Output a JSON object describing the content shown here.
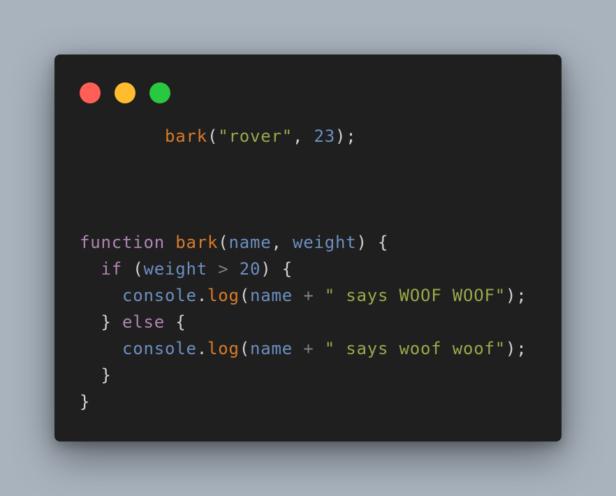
{
  "window": {
    "buttons": {
      "close": "close",
      "minimize": "minimize",
      "maximize": "maximize"
    },
    "colors": {
      "close": "#ff5f57",
      "minimize": "#febc2e",
      "maximize": "#28c840",
      "background": "#1f1f1f"
    }
  },
  "code": {
    "line1": {
      "fn": "bark",
      "open": "(",
      "str": "\"rover\"",
      "comma": ",",
      "num": "23",
      "close": ");"
    },
    "line2": {
      "kw": "function",
      "fn": "bark",
      "open": "(",
      "p1": "name",
      "comma": ",",
      "p2": "weight",
      "close": ") {"
    },
    "line3": {
      "kw": "if",
      "open": "(",
      "var": "weight",
      "op": ">",
      "num": "20",
      "close": ") {"
    },
    "line4": {
      "obj": "console",
      "dot": ".",
      "fn": "log",
      "open": "(",
      "var": "name",
      "op": "+",
      "str": "\" says WOOF WOOF\"",
      "close": ");"
    },
    "line5": {
      "brace": "}",
      "kw": "else",
      "open": "{"
    },
    "line6": {
      "obj": "console",
      "dot": ".",
      "fn": "log",
      "open": "(",
      "var": "name",
      "op": "+",
      "str": "\" says woof woof\"",
      "close": ");"
    },
    "line7": {
      "brace": "}"
    },
    "line8": {
      "brace": "}"
    }
  }
}
